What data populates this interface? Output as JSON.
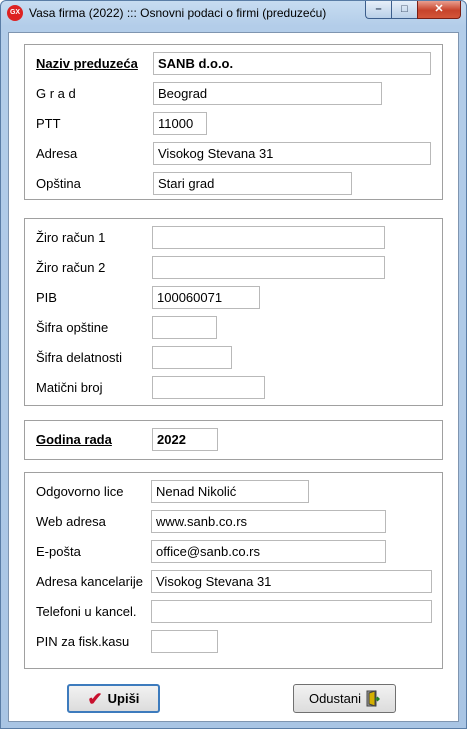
{
  "window": {
    "title": "Vasa firma (2022) ::: Osnovni podaci o firmi (preduzeću)",
    "icon_text": "GX"
  },
  "group1": {
    "naziv_label": "Naziv preduzeća",
    "naziv_value": "SANB d.o.o.",
    "grad_label": "G r a d",
    "grad_value": "Beograd",
    "ptt_label": "PTT",
    "ptt_value": "11000",
    "adresa_label": "Adresa",
    "adresa_value": "Visokog Stevana 31",
    "opstina_label": "Opština",
    "opstina_value": "Stari grad"
  },
  "group2": {
    "ziro1_label": "Žiro račun 1",
    "ziro1_value": "",
    "ziro2_label": "Žiro račun 2",
    "ziro2_value": "",
    "pib_label": "PIB",
    "pib_value": "100060071",
    "sifra_opstine_label": "Šifra opštine",
    "sifra_opstine_value": "",
    "sifra_delatnosti_label": "Šifra delatnosti",
    "sifra_delatnosti_value": "",
    "maticni_label": "Matični broj",
    "maticni_value": ""
  },
  "group3": {
    "godina_label": "Godina rada",
    "godina_value": "2022"
  },
  "group4": {
    "odgovorno_label": "Odgovorno lice",
    "odgovorno_value": "Nenad Nikolić",
    "web_label": "Web adresa",
    "web_value": "www.sanb.co.rs",
    "eposta_label": "E-pošta",
    "eposta_value": "office@sanb.co.rs",
    "kancelarija_label": "Adresa kancelarije",
    "kancelarija_value": "Visokog Stevana 31",
    "telefoni_label": "Telefoni u kancel.",
    "telefoni_value": "",
    "pin_label": "PIN za fisk.kasu",
    "pin_value": ""
  },
  "buttons": {
    "save_label": "Upiši",
    "cancel_label": "Odustani"
  },
  "icons": {
    "app": "app-logo-icon",
    "save": "checkmark-icon",
    "cancel": "door-exit-icon"
  },
  "colors": {
    "check": "#c8102e",
    "focus_border": "#3d7bbd",
    "close_button": "#c7432b"
  }
}
